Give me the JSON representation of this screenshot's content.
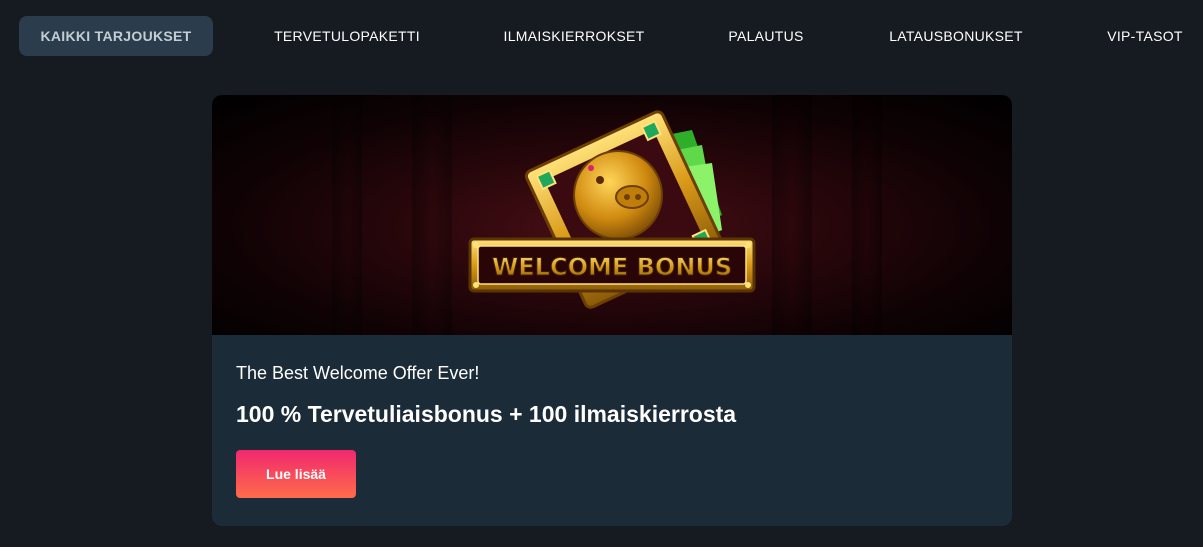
{
  "nav": {
    "tabs": [
      {
        "label": "KAIKKI TARJOUKSET",
        "active": true
      },
      {
        "label": "TERVETULOPAKETTI",
        "active": false
      },
      {
        "label": "ILMAISKIERROKSET",
        "active": false
      },
      {
        "label": "PALAUTUS",
        "active": false
      },
      {
        "label": "LATAUSBONUKSET",
        "active": false
      },
      {
        "label": "VIP-TASOT",
        "active": false
      }
    ]
  },
  "offer": {
    "banner_text": "WELCOME BONUS",
    "subtitle": "The Best Welcome Offer Ever!",
    "headline": "100 % Tervetuliaisbonus + 100 ilmaiskierrosta",
    "cta_label": "Lue lisää"
  },
  "colors": {
    "page_bg": "#151b21",
    "active_tab_bg": "#2b3d4c",
    "card_bg": "#1b2b38",
    "cta_gradient_start": "#f0286f",
    "cta_gradient_end": "#ff6b4a"
  }
}
